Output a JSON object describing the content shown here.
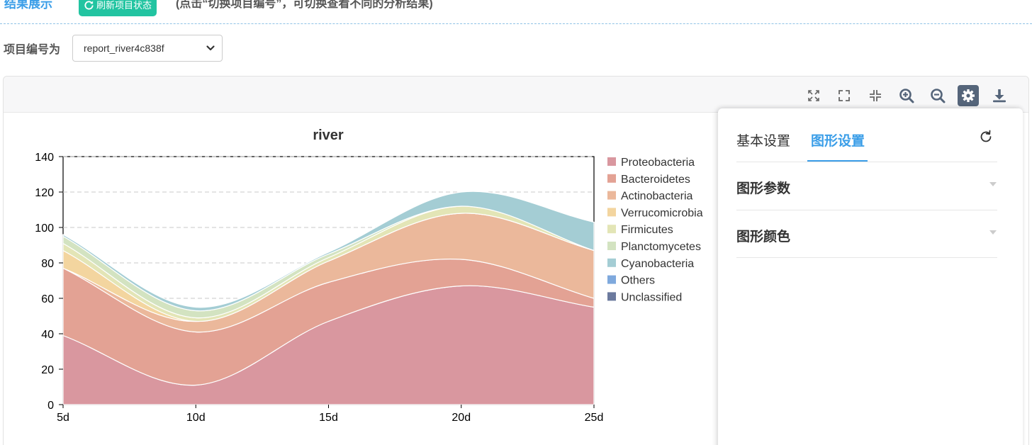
{
  "header": {
    "section_title": "结果展示",
    "refresh_label": "刷新项目状态",
    "hint": "(点击“切换项目编号”，可切换查看不同的分析结果)"
  },
  "project": {
    "label": "项目编号为",
    "selected": "report_river4c838f"
  },
  "toolbar": {
    "icons": [
      "expand-icon",
      "fullscreen-icon",
      "compress-icon",
      "zoom-in-icon",
      "zoom-out-icon",
      "gear-icon",
      "download-icon"
    ],
    "active": "gear-icon",
    "active_color": "#55657a"
  },
  "settings_panel": {
    "tabs": [
      {
        "label": "基本设置",
        "active": false
      },
      {
        "label": "图形设置",
        "active": true
      }
    ],
    "accent": "#3b9ee8",
    "sections": [
      {
        "label": "图形参数",
        "expanded": false
      },
      {
        "label": "图形颜色",
        "expanded": false
      }
    ]
  },
  "chart_data": {
    "type": "area",
    "stacked": true,
    "smooth": true,
    "title": "river",
    "xlabel": "",
    "ylabel": "",
    "x": [
      "5d",
      "10d",
      "15d",
      "20d",
      "25d"
    ],
    "ylim": [
      0,
      140
    ],
    "yticks": [
      0,
      20,
      40,
      60,
      80,
      100,
      120,
      140
    ],
    "grid": "horizontal-dashed",
    "legend": "right",
    "series": [
      {
        "name": "Proteobacteria",
        "color": "#d9979f",
        "values": [
          39,
          11,
          47,
          67,
          55
        ]
      },
      {
        "name": "Bacteroidetes",
        "color": "#e3a294",
        "values": [
          38,
          30,
          22,
          15,
          5
        ]
      },
      {
        "name": "Actinobacteria",
        "color": "#ebb89b",
        "values": [
          0,
          6,
          12,
          26,
          27
        ]
      },
      {
        "name": "Verrucomicrobia",
        "color": "#f3d59f",
        "values": [
          10,
          0,
          0,
          0,
          0
        ]
      },
      {
        "name": "Firmicutes",
        "color": "#e3e5b6",
        "values": [
          4,
          2,
          2,
          4,
          0
        ]
      },
      {
        "name": "Planctomycetes",
        "color": "#d3e3c1",
        "values": [
          4,
          4,
          2,
          0,
          0
        ]
      },
      {
        "name": "Cyanobacteria",
        "color": "#a4cdd4",
        "values": [
          1,
          2,
          1,
          8,
          16
        ]
      },
      {
        "name": "Others",
        "color": "#7fa9dd",
        "values": [
          0,
          0,
          0,
          0,
          0
        ]
      },
      {
        "name": "Unclassified",
        "color": "#6c7a9e",
        "values": [
          0,
          0,
          0,
          0,
          0
        ]
      }
    ]
  }
}
